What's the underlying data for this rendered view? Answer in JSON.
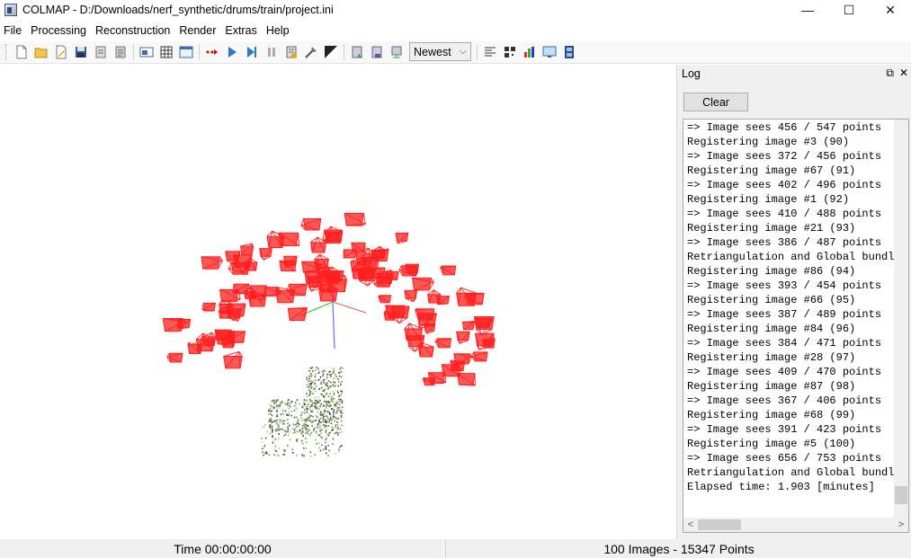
{
  "window": {
    "title": "COLMAP - D:/Downloads/nerf_synthetic/drums/train/project.ini",
    "minimize_glyph": "—",
    "maximize_glyph": "☐",
    "close_glyph": "✕"
  },
  "menu": {
    "items": [
      {
        "label": "File"
      },
      {
        "label": "Processing"
      },
      {
        "label": "Reconstruction"
      },
      {
        "label": "Render"
      },
      {
        "label": "Extras"
      },
      {
        "label": "Help"
      }
    ]
  },
  "toolbar": {
    "reconstruction_select": "Newest",
    "icons": [
      "new-project-icon",
      "open-project-icon",
      "edit-project-icon",
      "save-project-icon",
      "import-model-icon",
      "export-model-icon",
      "feature-extraction-icon",
      "feature-matching-icon",
      "database-management-icon",
      "automatic-reconstruction-icon",
      "start-reconstruction-icon",
      "step-reconstruction-icon",
      "pause-reconstruction-icon",
      "reset-reconstruction-icon",
      "bundle-adjustment-icon",
      "dense-reconstruction-icon",
      "render-options-icon",
      "render-toggle-icon",
      "reconstruction-stats-icon",
      "match-matrix-icon",
      "show-log-icon",
      "grab-image-icon",
      "grab-movie-icon"
    ]
  },
  "log": {
    "title": "Log",
    "float_glyph": "⧉",
    "close_glyph": "✕",
    "clear_label": "Clear",
    "lines": [
      "=> Image sees 456 / 547 points",
      "Registering image #3 (90)",
      "=> Image sees 372 / 456 points",
      "Registering image #67 (91)",
      "=> Image sees 402 / 496 points",
      "Registering image #1 (92)",
      "=> Image sees 410 / 488 points",
      "Registering image #21 (93)",
      "=> Image sees 386 / 487 points",
      "Retriangulation and Global bundle adjustment",
      "Registering image #86 (94)",
      "=> Image sees 393 / 454 points",
      "Registering image #66 (95)",
      "=> Image sees 387 / 489 points",
      "Registering image #84 (96)",
      "=> Image sees 384 / 471 points",
      "Registering image #28 (97)",
      "=> Image sees 409 / 470 points",
      "Registering image #87 (98)",
      "=> Image sees 367 / 406 points",
      "Registering image #68 (99)",
      "=> Image sees 391 / 423 points",
      "Registering image #5 (100)",
      "=> Image sees 656 / 753 points",
      "Retriangulation and Global bundle adjustment",
      "Elapsed time: 1.903 [minutes]"
    ],
    "scroll_left_glyph": "<",
    "scroll_right_glyph": ">"
  },
  "viewport": {
    "camera_color": "#ff1e1e",
    "camera_count": 100,
    "point_count": 15347
  },
  "status": {
    "time": "Time 00:00:00:00",
    "summary": "100 Images - 15347 Points"
  }
}
